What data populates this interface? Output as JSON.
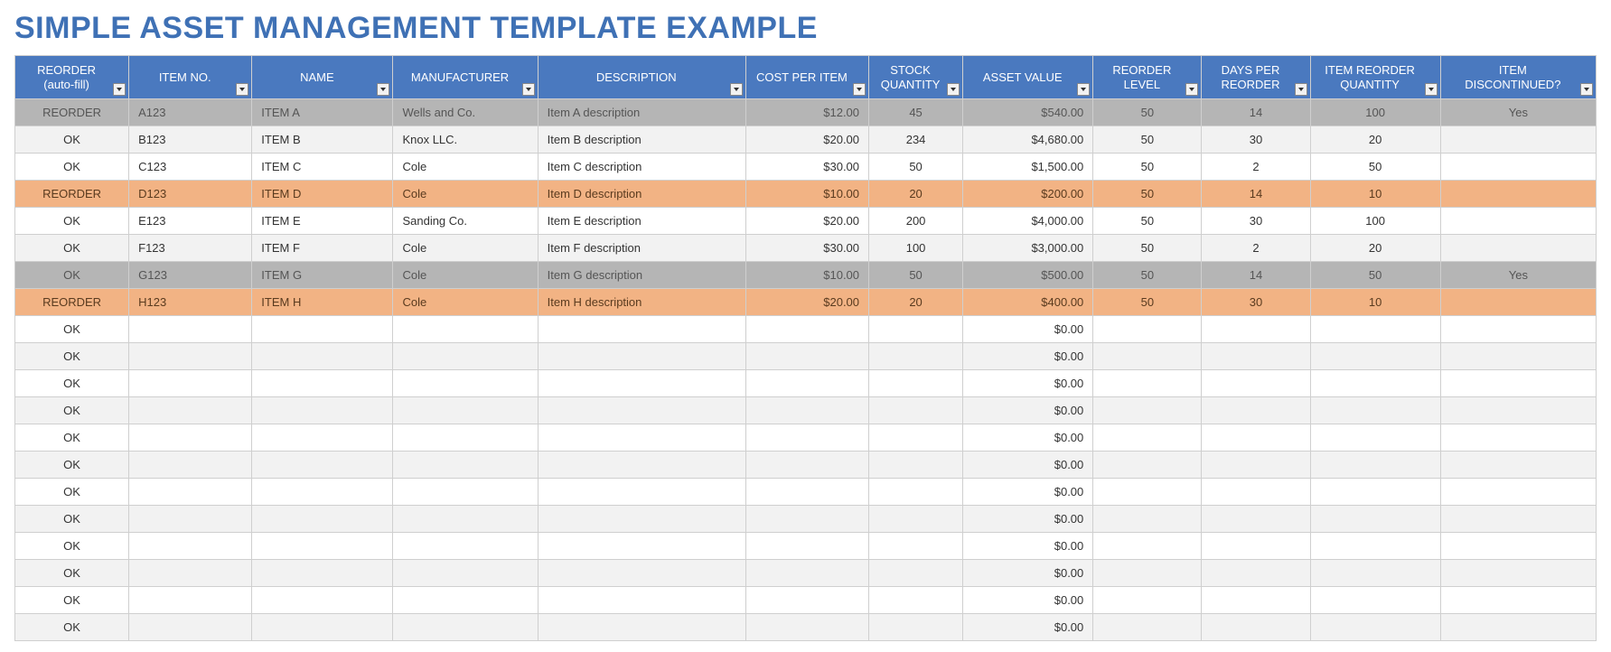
{
  "title": "SIMPLE ASSET MANAGEMENT TEMPLATE EXAMPLE",
  "columns": [
    {
      "label": "REORDER\n(auto-fill)",
      "align": "center"
    },
    {
      "label": "ITEM NO.",
      "align": "left"
    },
    {
      "label": "NAME",
      "align": "left"
    },
    {
      "label": "MANUFACTURER",
      "align": "left"
    },
    {
      "label": "DESCRIPTION",
      "align": "left"
    },
    {
      "label": "COST PER ITEM",
      "align": "right"
    },
    {
      "label": "STOCK\nQUANTITY",
      "align": "center"
    },
    {
      "label": "ASSET VALUE",
      "align": "right"
    },
    {
      "label": "REORDER\nLEVEL",
      "align": "center"
    },
    {
      "label": "DAYS PER\nREORDER",
      "align": "center"
    },
    {
      "label": "ITEM REORDER\nQUANTITY",
      "align": "center"
    },
    {
      "label": "ITEM\nDISCONTINUED?",
      "align": "center"
    }
  ],
  "rows": [
    {
      "status": "REORDER",
      "item_no": "A123",
      "name": "ITEM A",
      "manufacturer": "Wells and Co.",
      "description": "Item A description",
      "cost": "$12.00",
      "stock": "45",
      "asset": "$540.00",
      "rlevel": "50",
      "days": "14",
      "rqty": "100",
      "disc": "Yes",
      "style": "discontinued"
    },
    {
      "status": "OK",
      "item_no": "B123",
      "name": "ITEM B",
      "manufacturer": "Knox LLC.",
      "description": "Item B description",
      "cost": "$20.00",
      "stock": "234",
      "asset": "$4,680.00",
      "rlevel": "50",
      "days": "30",
      "rqty": "20",
      "disc": "",
      "style": ""
    },
    {
      "status": "OK",
      "item_no": "C123",
      "name": "ITEM C",
      "manufacturer": "Cole",
      "description": "Item C description",
      "cost": "$30.00",
      "stock": "50",
      "asset": "$1,500.00",
      "rlevel": "50",
      "days": "2",
      "rqty": "50",
      "disc": "",
      "style": ""
    },
    {
      "status": "REORDER",
      "item_no": "D123",
      "name": "ITEM D",
      "manufacturer": "Cole",
      "description": "Item D description",
      "cost": "$10.00",
      "stock": "20",
      "asset": "$200.00",
      "rlevel": "50",
      "days": "14",
      "rqty": "10",
      "disc": "",
      "style": "reorder"
    },
    {
      "status": "OK",
      "item_no": "E123",
      "name": "ITEM E",
      "manufacturer": "Sanding Co.",
      "description": "Item E description",
      "cost": "$20.00",
      "stock": "200",
      "asset": "$4,000.00",
      "rlevel": "50",
      "days": "30",
      "rqty": "100",
      "disc": "",
      "style": ""
    },
    {
      "status": "OK",
      "item_no": "F123",
      "name": "ITEM F",
      "manufacturer": "Cole",
      "description": "Item F description",
      "cost": "$30.00",
      "stock": "100",
      "asset": "$3,000.00",
      "rlevel": "50",
      "days": "2",
      "rqty": "20",
      "disc": "",
      "style": ""
    },
    {
      "status": "OK",
      "item_no": "G123",
      "name": "ITEM G",
      "manufacturer": "Cole",
      "description": "Item G description",
      "cost": "$10.00",
      "stock": "50",
      "asset": "$500.00",
      "rlevel": "50",
      "days": "14",
      "rqty": "50",
      "disc": "Yes",
      "style": "discontinued"
    },
    {
      "status": "REORDER",
      "item_no": "H123",
      "name": "ITEM H",
      "manufacturer": "Cole",
      "description": "Item H description",
      "cost": "$20.00",
      "stock": "20",
      "asset": "$400.00",
      "rlevel": "50",
      "days": "30",
      "rqty": "10",
      "disc": "",
      "style": "reorder"
    },
    {
      "status": "OK",
      "item_no": "",
      "name": "",
      "manufacturer": "",
      "description": "",
      "cost": "",
      "stock": "",
      "asset": "$0.00",
      "rlevel": "",
      "days": "",
      "rqty": "",
      "disc": "",
      "style": ""
    },
    {
      "status": "OK",
      "item_no": "",
      "name": "",
      "manufacturer": "",
      "description": "",
      "cost": "",
      "stock": "",
      "asset": "$0.00",
      "rlevel": "",
      "days": "",
      "rqty": "",
      "disc": "",
      "style": ""
    },
    {
      "status": "OK",
      "item_no": "",
      "name": "",
      "manufacturer": "",
      "description": "",
      "cost": "",
      "stock": "",
      "asset": "$0.00",
      "rlevel": "",
      "days": "",
      "rqty": "",
      "disc": "",
      "style": ""
    },
    {
      "status": "OK",
      "item_no": "",
      "name": "",
      "manufacturer": "",
      "description": "",
      "cost": "",
      "stock": "",
      "asset": "$0.00",
      "rlevel": "",
      "days": "",
      "rqty": "",
      "disc": "",
      "style": ""
    },
    {
      "status": "OK",
      "item_no": "",
      "name": "",
      "manufacturer": "",
      "description": "",
      "cost": "",
      "stock": "",
      "asset": "$0.00",
      "rlevel": "",
      "days": "",
      "rqty": "",
      "disc": "",
      "style": ""
    },
    {
      "status": "OK",
      "item_no": "",
      "name": "",
      "manufacturer": "",
      "description": "",
      "cost": "",
      "stock": "",
      "asset": "$0.00",
      "rlevel": "",
      "days": "",
      "rqty": "",
      "disc": "",
      "style": ""
    },
    {
      "status": "OK",
      "item_no": "",
      "name": "",
      "manufacturer": "",
      "description": "",
      "cost": "",
      "stock": "",
      "asset": "$0.00",
      "rlevel": "",
      "days": "",
      "rqty": "",
      "disc": "",
      "style": ""
    },
    {
      "status": "OK",
      "item_no": "",
      "name": "",
      "manufacturer": "",
      "description": "",
      "cost": "",
      "stock": "",
      "asset": "$0.00",
      "rlevel": "",
      "days": "",
      "rqty": "",
      "disc": "",
      "style": ""
    },
    {
      "status": "OK",
      "item_no": "",
      "name": "",
      "manufacturer": "",
      "description": "",
      "cost": "",
      "stock": "",
      "asset": "$0.00",
      "rlevel": "",
      "days": "",
      "rqty": "",
      "disc": "",
      "style": ""
    },
    {
      "status": "OK",
      "item_no": "",
      "name": "",
      "manufacturer": "",
      "description": "",
      "cost": "",
      "stock": "",
      "asset": "$0.00",
      "rlevel": "",
      "days": "",
      "rqty": "",
      "disc": "",
      "style": ""
    },
    {
      "status": "OK",
      "item_no": "",
      "name": "",
      "manufacturer": "",
      "description": "",
      "cost": "",
      "stock": "",
      "asset": "$0.00",
      "rlevel": "",
      "days": "",
      "rqty": "",
      "disc": "",
      "style": ""
    },
    {
      "status": "OK",
      "item_no": "",
      "name": "",
      "manufacturer": "",
      "description": "",
      "cost": "",
      "stock": "",
      "asset": "$0.00",
      "rlevel": "",
      "days": "",
      "rqty": "",
      "disc": "",
      "style": ""
    }
  ]
}
